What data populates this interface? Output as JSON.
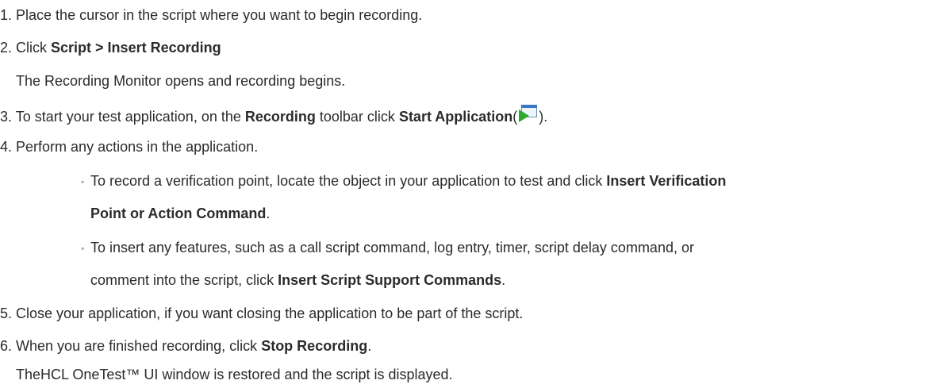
{
  "steps": [
    {
      "num": "1.",
      "text": "Place the cursor in the script where you want to begin recording."
    },
    {
      "num": "2.",
      "text_before": "Click ",
      "bold": "Script > Insert Recording",
      "note": "The Recording Monitor opens and recording begins."
    },
    {
      "num": "3.",
      "text_before": "To start your test application, on the ",
      "bold1": "Recording",
      "text_mid": " toolbar click ",
      "bold2": "Start Application",
      "open_paren": "(",
      "close_paren": ").",
      "icon": "start-application-icon"
    },
    {
      "num": "4.",
      "text": "Perform any actions in the application.",
      "bullets": [
        {
          "marker": "◦",
          "text_before": "To record a verification point, locate the object in your application to test and click ",
          "bold_part1": "Insert Verification",
          "bold_part2": "Point or Action Command",
          "text_after": "."
        },
        {
          "marker": "◦",
          "text_line1": "To insert any features, such as a call script command, log entry, timer, script delay command, or",
          "text_before": "comment into the script, click ",
          "bold": "Insert Script Support Commands",
          "text_after": "."
        }
      ]
    },
    {
      "num": "5.",
      "text": "Close your application, if you want closing the application to be part of the script."
    },
    {
      "num": "6.",
      "text_before": "When you are finished recording, click ",
      "bold": "Stop Recording",
      "text_after": ".",
      "note": "TheHCL OneTest™ UI window is restored and the script is displayed."
    }
  ],
  "colors": {
    "text": "#2b2b2b",
    "background": "#ffffff",
    "icon_play": "#2ea82e",
    "icon_window": "#3b78c2"
  }
}
